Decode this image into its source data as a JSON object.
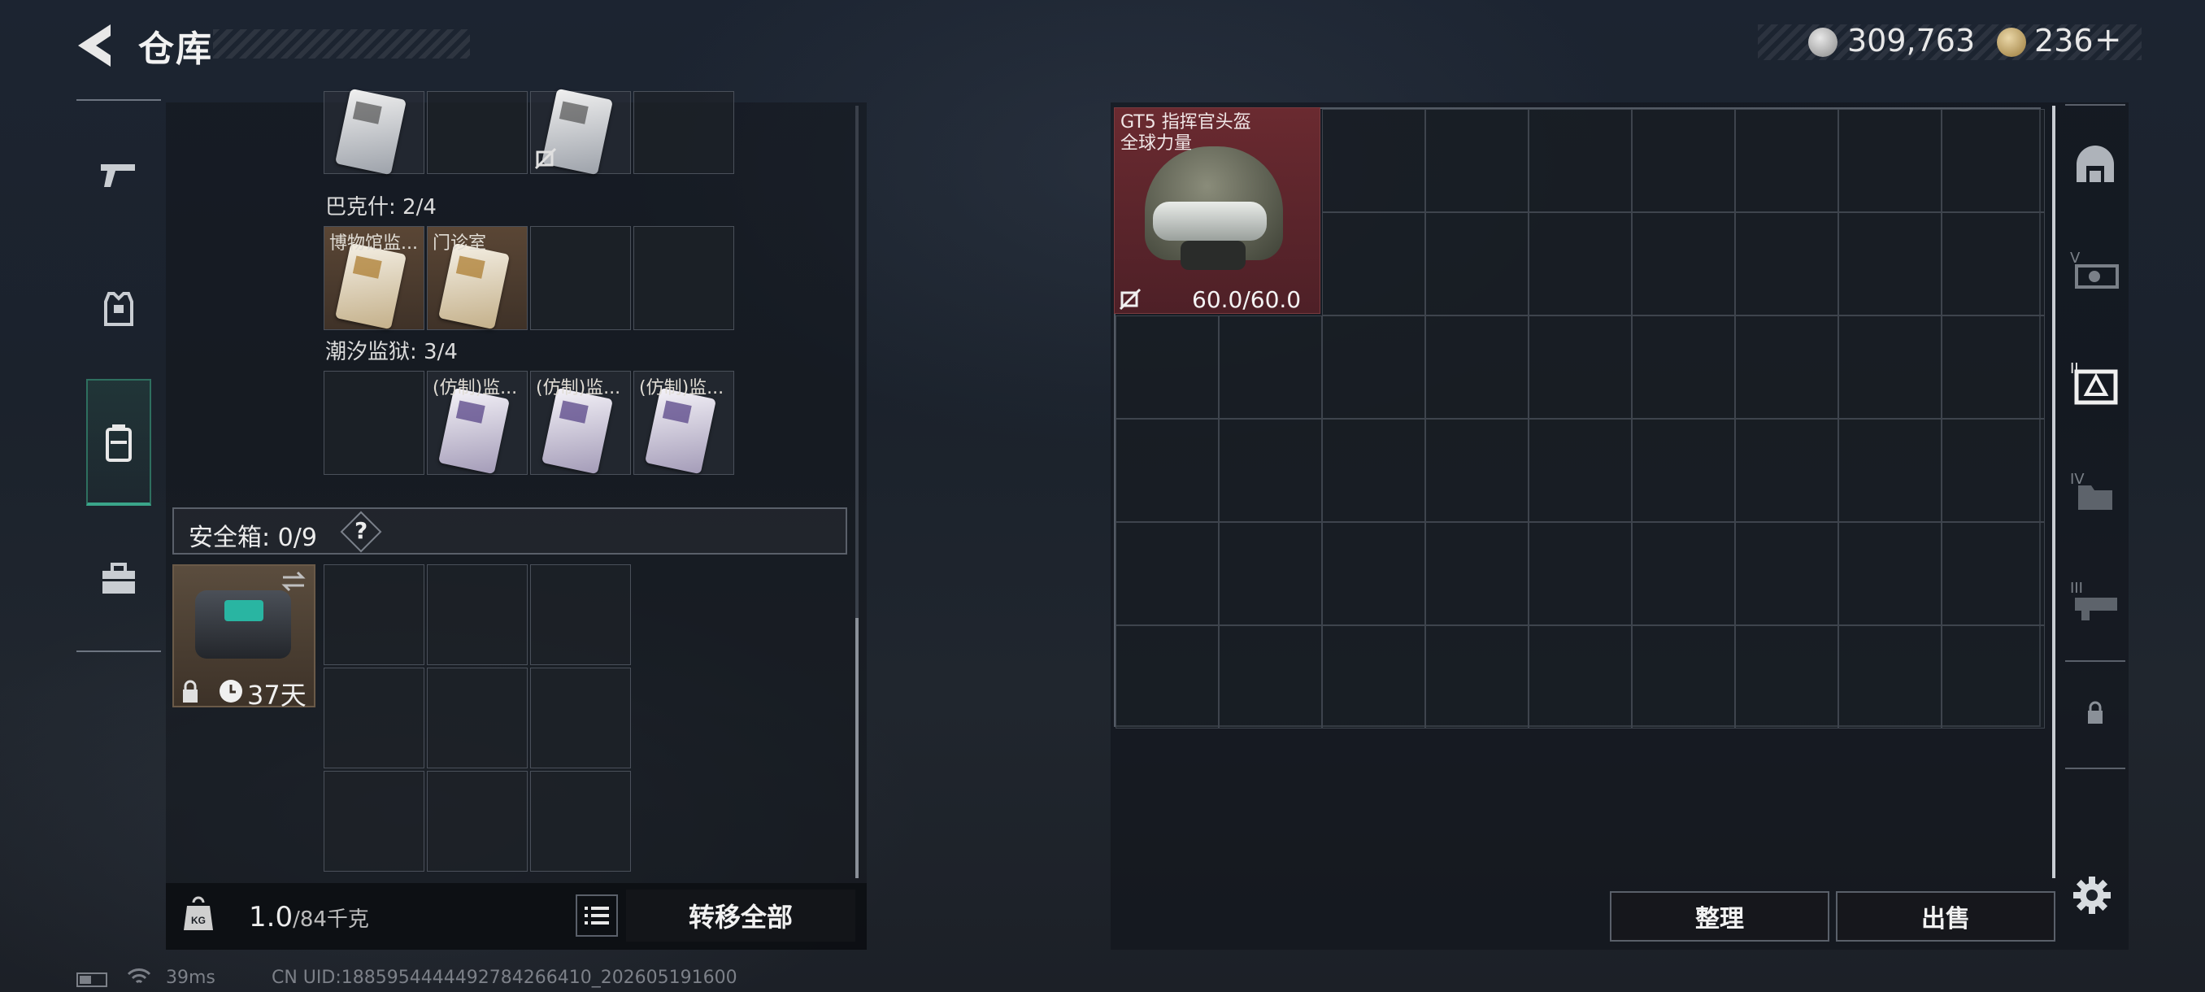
{
  "header": {
    "title": "仓库",
    "currency_silver": "309,763",
    "currency_gold": "236",
    "add_label": "+"
  },
  "left_nav": {
    "items": [
      {
        "name": "weapon",
        "icon": "gun-icon"
      },
      {
        "name": "equipment",
        "icon": "armor-vest-icon"
      },
      {
        "name": "backpack",
        "icon": "backpack-icon",
        "selected": true
      },
      {
        "name": "toolbox",
        "icon": "toolbox-icon"
      }
    ]
  },
  "keycards": {
    "section_baksh": "巴克什: 2/4",
    "section_prison": "潮汐监狱: 3/4",
    "baksh_card_1": "博物馆监...",
    "baksh_card_2": "门诊室",
    "prison_card_1": "(仿制)监...",
    "prison_card_2": "(仿制)监...",
    "prison_card_3": "(仿制)监..."
  },
  "safe": {
    "label": "安全箱: 0/9",
    "help": "?",
    "duration": "37天"
  },
  "bottom": {
    "weight_value": "1.0",
    "weight_max": "/84千克",
    "transfer_all": "转移全部"
  },
  "stash": {
    "item_name": "GT5 指挥官头盔",
    "item_sub": "全球力量",
    "durability": "60.0/60.0"
  },
  "right_nav": {
    "items": [
      {
        "name": "helmet-slot",
        "icon": "helmet-icon"
      },
      {
        "name": "tier-v",
        "icon": "tier-v-icon"
      },
      {
        "name": "tier-ii",
        "icon": "tier-ii-icon",
        "selected": true
      },
      {
        "name": "tier-iv",
        "icon": "tier-iv-icon"
      },
      {
        "name": "tier-iii",
        "icon": "tier-iii-icon"
      },
      {
        "name": "locked",
        "icon": "lock-icon"
      }
    ]
  },
  "actions": {
    "organize": "整理",
    "sell": "出售"
  },
  "status": {
    "ping": "39ms",
    "uid": "CN UID:1885954444492784266410_202605191600"
  },
  "colors": {
    "accent_green": "#3aa58a",
    "item_red": "#6a2a30",
    "keycard_brown": "#5a4635"
  }
}
